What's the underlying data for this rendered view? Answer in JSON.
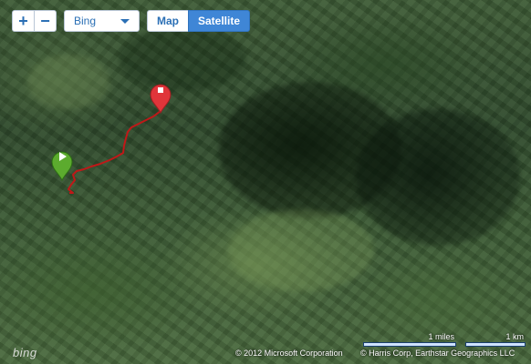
{
  "controls": {
    "zoom_in": "+",
    "zoom_out": "−",
    "source": "Bing",
    "map_types": [
      "Map",
      "Satellite"
    ],
    "active_type": "Satellite"
  },
  "attribution": {
    "logo": "bing",
    "microsoft": "© 2012 Microsoft Corporation",
    "harris": "© Harris Corp, Earthstar Geographics LLC"
  },
  "scale": {
    "miles": "1 miles",
    "km": "1 km"
  },
  "markers": {
    "start": {
      "icon": "play-icon",
      "color": "#5cab2e"
    },
    "end": {
      "icon": "stop-icon",
      "color": "#e0353a"
    }
  },
  "route": {
    "color": "#c01818"
  }
}
